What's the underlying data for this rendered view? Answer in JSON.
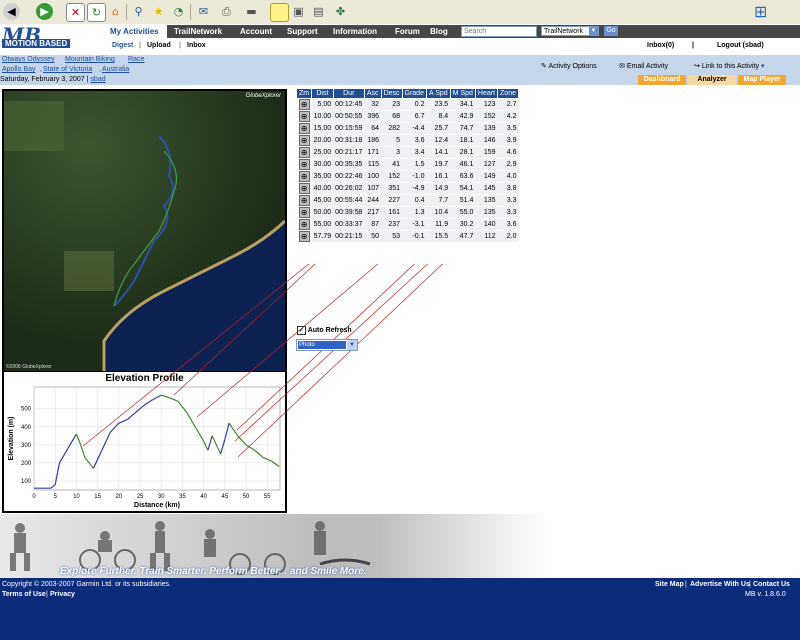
{
  "header": {
    "logo_mark": "MB",
    "logo_text": "MOTION BASED",
    "nav": [
      "My Activities",
      "TrailNetwork",
      "Account",
      "Support",
      "Information",
      "Forum",
      "Blog"
    ],
    "search_placeholder": "Search",
    "search_scope": "TrailNetwork",
    "go_label": "Go",
    "inbox": "Inbox(0)",
    "logout": "Logout (sbad)",
    "subnav": [
      "Digest",
      "Upload",
      "Inbox"
    ]
  },
  "breadcrumbs": {
    "line1": [
      "Otways Odyssey",
      "Mountain Biking",
      "Race"
    ],
    "line2": [
      "Apollo Bay",
      "State of Victoria",
      "Australia"
    ],
    "date": "Saturday, February 3, 2007",
    "user": "sbad"
  },
  "actions": {
    "options": "Activity Options",
    "email": "Email Activity",
    "link": "Link to this Activity"
  },
  "view_tabs": [
    "Dashboard",
    "Analyzer",
    "Map Player"
  ],
  "map": {
    "brand": "GlobeXplorer",
    "copyright": "©2006 GlobeXplorer"
  },
  "profile": {
    "title": "Elevation Profile",
    "xlabel": "Distance (km)",
    "ylabel": "Elevation (m)",
    "xticks": [
      "0",
      "5",
      "10",
      "15",
      "20",
      "25",
      "30",
      "35",
      "40",
      "45",
      "50",
      "55"
    ],
    "yticks": [
      "100",
      "200",
      "300",
      "400",
      "500"
    ]
  },
  "chart_data": {
    "type": "line",
    "title": "Elevation Profile",
    "xlabel": "Distance (km)",
    "ylabel": "Elevation (m)",
    "xlim": [
      0,
      58
    ],
    "ylim": [
      50,
      620
    ],
    "x": [
      0,
      4,
      5,
      6,
      8,
      10,
      11,
      12,
      14,
      16,
      18,
      20,
      22,
      24,
      26,
      28,
      30,
      32,
      34,
      36,
      38,
      40,
      41,
      42,
      43,
      44,
      45,
      46,
      48,
      50,
      52,
      54,
      56,
      57.8
    ],
    "y": [
      60,
      60,
      80,
      200,
      280,
      360,
      300,
      230,
      170,
      270,
      370,
      420,
      440,
      480,
      520,
      550,
      575,
      560,
      540,
      480,
      400,
      320,
      270,
      350,
      300,
      250,
      330,
      420,
      350,
      300,
      270,
      230,
      210,
      180
    ]
  },
  "table": {
    "headers": [
      "Zm",
      "Dist",
      "Dur",
      "Asc",
      "Desc",
      "Grade",
      "A Spd",
      "M Spd",
      "Heart",
      "Zone"
    ],
    "rows": [
      [
        "5.00",
        "00:12:45",
        "32",
        "23",
        "0.2",
        "23.5",
        "34.1",
        "123",
        "2.7"
      ],
      [
        "10.00",
        "00:50:55",
        "396",
        "68",
        "6.7",
        "8.4",
        "42.9",
        "152",
        "4.2"
      ],
      [
        "15.00",
        "00:15:59",
        "64",
        "282",
        "-4.4",
        "25.7",
        "74.7",
        "139",
        "3.5"
      ],
      [
        "20.00",
        "00:31:18",
        "186",
        "5",
        "3.6",
        "12.4",
        "18.1",
        "146",
        "3.9"
      ],
      [
        "25.00",
        "00:21:17",
        "171",
        "3",
        "3.4",
        "14.1",
        "28.1",
        "159",
        "4.6"
      ],
      [
        "30.00",
        "00:35:35",
        "115",
        "41",
        "1.5",
        "19.7",
        "46.1",
        "127",
        "2.9"
      ],
      [
        "35.00",
        "00:22:46",
        "100",
        "152",
        "-1.0",
        "16.1",
        "63.6",
        "149",
        "4.0"
      ],
      [
        "40.00",
        "00:26:02",
        "107",
        "351",
        "-4.9",
        "14.9",
        "54.1",
        "145",
        "3.8"
      ],
      [
        "45.00",
        "00:55:44",
        "244",
        "227",
        "0.4",
        "7.7",
        "51.4",
        "135",
        "3.3"
      ],
      [
        "50.00",
        "00:39:58",
        "217",
        "161",
        "1.3",
        "10.4",
        "55.0",
        "135",
        "3.3"
      ],
      [
        "55.00",
        "00:33:37",
        "87",
        "237",
        "-3.1",
        "11.9",
        "30.2",
        "140",
        "3.6"
      ],
      [
        "57.79",
        "00:21:15",
        "50",
        "53",
        "-0.1",
        "15.5",
        "47.7",
        "112",
        "2.0"
      ]
    ]
  },
  "auto_refresh_label": "Auto Refresh",
  "map_type": "Photo",
  "footer": {
    "tagline": "Explore Further. Train Smarter. Perform Better... and Smile More.",
    "copyright": "Copyright © 2003-2007 Garmin Ltd. or its subsidiaries.",
    "terms": "Terms of Use",
    "privacy": "Privacy",
    "sitemap": "Site Map",
    "advertise": "Advertise With Us",
    "contact": "Contact Us",
    "version": "MB v. 1.8.6.0"
  },
  "colors": {
    "nav_bg": "#474747",
    "brand_blue": "#224f93",
    "band": "#c5d5ea",
    "footer": "#0a2c7b",
    "tab_orange": "#f0a830"
  }
}
